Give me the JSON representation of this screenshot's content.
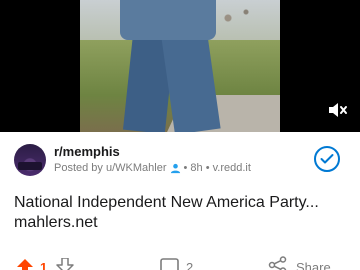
{
  "post": {
    "subreddit": "r/memphis",
    "meta_prefix": "Posted by u/WKMahler",
    "meta_suffix": "• 8h • v.redd.it",
    "title": "National Independent New America Party...",
    "domain": "mahlers.net"
  },
  "actions": {
    "vote_count": "1",
    "comment_count": "2",
    "share_label": "Share"
  },
  "colors": {
    "accent": "#0079d3",
    "upvote": "#ff4500",
    "muted_text": "#7c7c7c"
  },
  "icons": {
    "mute": "volume-mute-icon",
    "user": "user-icon",
    "check": "check-icon",
    "upvote": "upvote-arrow-icon",
    "downvote": "downvote-arrow-icon",
    "comment": "comment-icon",
    "share": "share-icon"
  }
}
